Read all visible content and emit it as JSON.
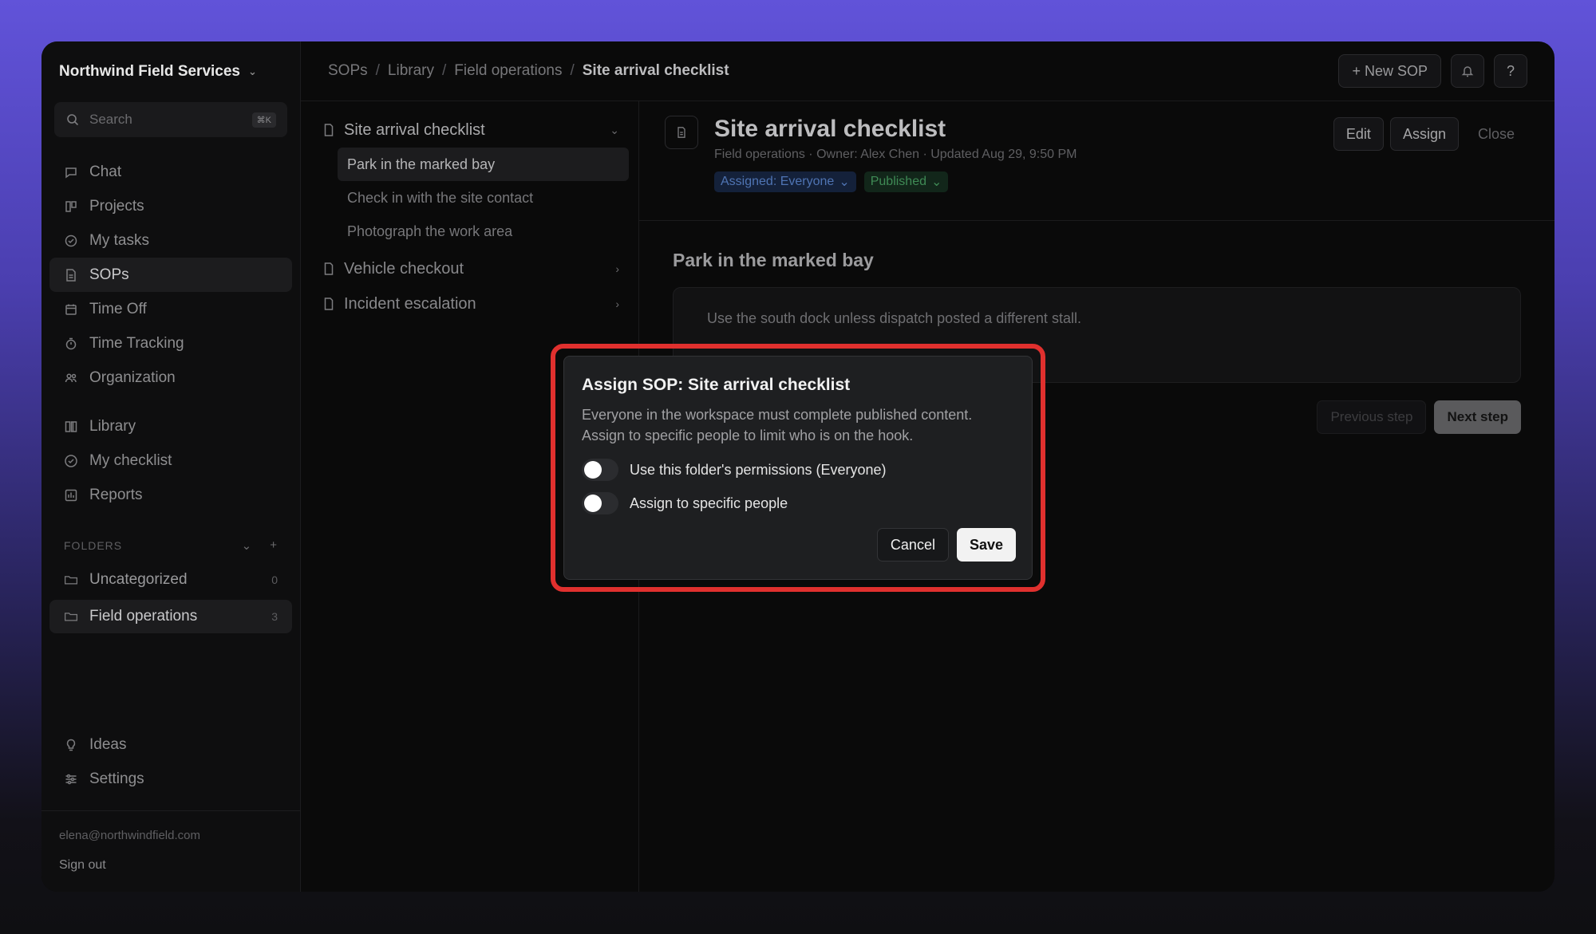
{
  "workspace": {
    "name": "Northwind Field Services"
  },
  "search": {
    "placeholder": "Search",
    "shortcut": "⌘K"
  },
  "nav_primary": [
    {
      "label": "Chat",
      "icon": "chat-icon"
    },
    {
      "label": "Projects",
      "icon": "projects-icon"
    },
    {
      "label": "My tasks",
      "icon": "check-circle-icon"
    },
    {
      "label": "SOPs",
      "icon": "document-icon",
      "active": true
    },
    {
      "label": "Time Off",
      "icon": "calendar-icon"
    },
    {
      "label": "Time Tracking",
      "icon": "timer-icon"
    },
    {
      "label": "Organization",
      "icon": "people-icon"
    }
  ],
  "nav_secondary": [
    {
      "label": "Library",
      "icon": "library-icon"
    },
    {
      "label": "My checklist",
      "icon": "check-circle-icon"
    },
    {
      "label": "Reports",
      "icon": "reports-icon"
    }
  ],
  "folders": {
    "heading": "FOLDERS",
    "items": [
      {
        "label": "Uncategorized",
        "count": "0"
      },
      {
        "label": "Field operations",
        "count": "3",
        "active": true
      }
    ]
  },
  "nav_bottom": [
    {
      "label": "Ideas",
      "icon": "lightbulb-icon"
    },
    {
      "label": "Settings",
      "icon": "sliders-icon"
    }
  ],
  "user": {
    "email": "elena@northwindfield.com",
    "signout": "Sign out"
  },
  "breadcrumb": {
    "c1": "SOPs",
    "c2": "Library",
    "c3": "Field operations",
    "current": "Site arrival checklist",
    "sep": "/"
  },
  "topbar": {
    "new_sop": "+ New SOP",
    "help": "?"
  },
  "tree": {
    "doc1": "Site arrival checklist",
    "steps": [
      "Park in the marked bay",
      "Check in with the site contact",
      "Photograph the work area"
    ],
    "doc2": "Vehicle checkout",
    "doc3": "Incident escalation"
  },
  "doc": {
    "title": "Site arrival checklist",
    "meta": "Field operations · Owner: Alex Chen · Updated Aug 29, 9:50 PM",
    "assigned_pill": "Assigned: Everyone",
    "status_pill": "Published",
    "edit": "Edit",
    "assign": "Assign",
    "close": "Close"
  },
  "step": {
    "title": "Park in the marked bay",
    "body": "Use the south dock unless dispatch posted a different stall.",
    "prev": "Previous step",
    "next": "Next step"
  },
  "modal": {
    "title": "Assign SOP: Site arrival checklist",
    "description": "Everyone in the workspace must complete published content. Assign to specific people to limit who is on the hook.",
    "option1": "Use this folder's permissions (Everyone)",
    "option2": "Assign to specific people",
    "cancel": "Cancel",
    "save": "Save"
  },
  "colors": {
    "highlight": "#e0302e",
    "background_top": "#6153d9"
  }
}
